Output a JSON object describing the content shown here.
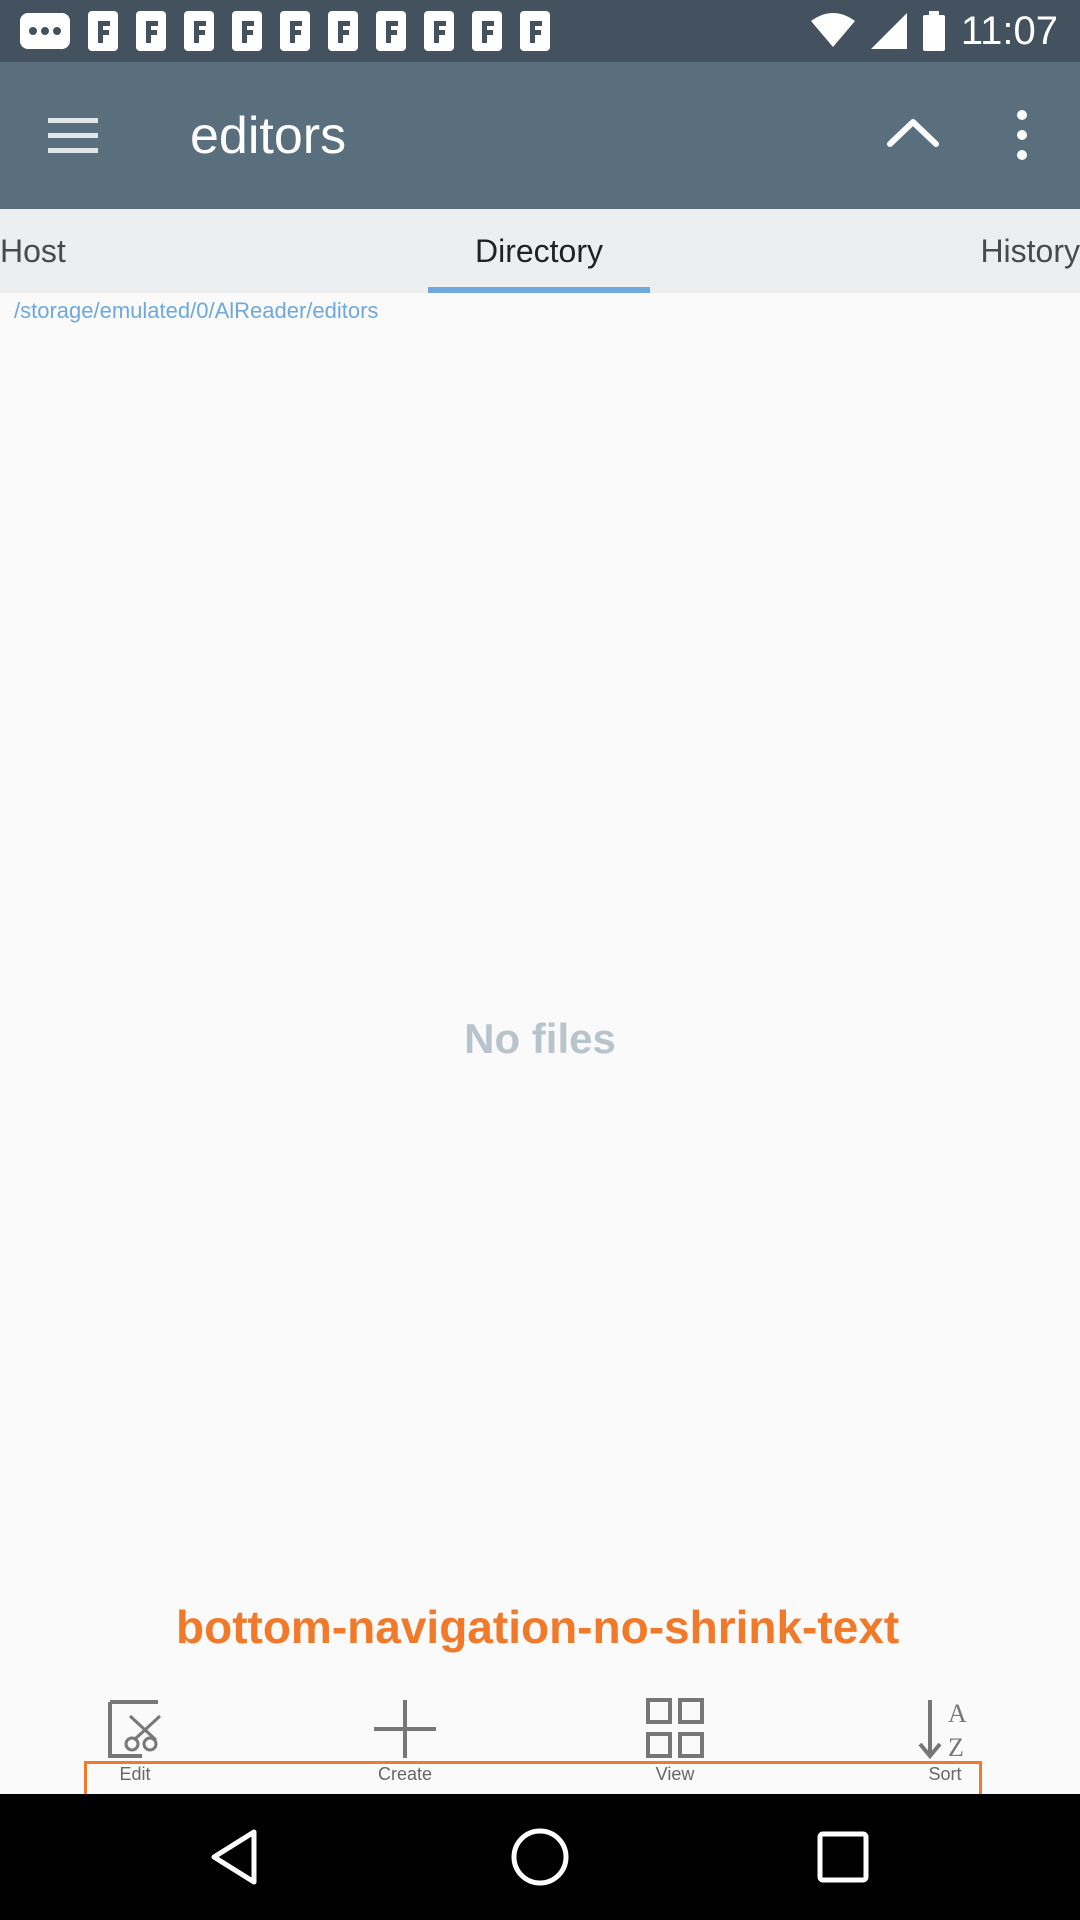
{
  "status_bar": {
    "time": "11:07",
    "icons": [
      "more-dots-icon",
      "f-icon",
      "f-icon",
      "f-icon",
      "f-icon",
      "f-icon",
      "f-icon",
      "f-icon",
      "f-icon",
      "f-icon",
      "f-icon",
      "wifi-icon",
      "signal-icon",
      "battery-icon"
    ]
  },
  "toolbar": {
    "title": "editors",
    "menu_icon": "hamburger-menu-icon",
    "up_icon": "chevron-up-icon",
    "more_icon": "more-vert-icon"
  },
  "tabs": [
    {
      "label": "Host"
    },
    {
      "label": "Directory",
      "selected": true
    },
    {
      "label": "History"
    }
  ],
  "path": "/storage/emulated/0/AlReader/editors",
  "empty_message": "No files",
  "annotation": "bottom-navigation-no-shrink-text",
  "bottom_nav": [
    {
      "label": "Edit",
      "icon": "cut-edit-icon"
    },
    {
      "label": "Create",
      "icon": "plus-icon"
    },
    {
      "label": "View",
      "icon": "grid-view-icon"
    },
    {
      "label": "Sort",
      "icon": "sort-az-icon"
    }
  ],
  "colors": {
    "status_bar": "#43525e",
    "toolbar": "#5a6f7d",
    "tab_indicator": "#6fa8dc",
    "annotation": "#f07a2a",
    "background": "#fafafa"
  }
}
